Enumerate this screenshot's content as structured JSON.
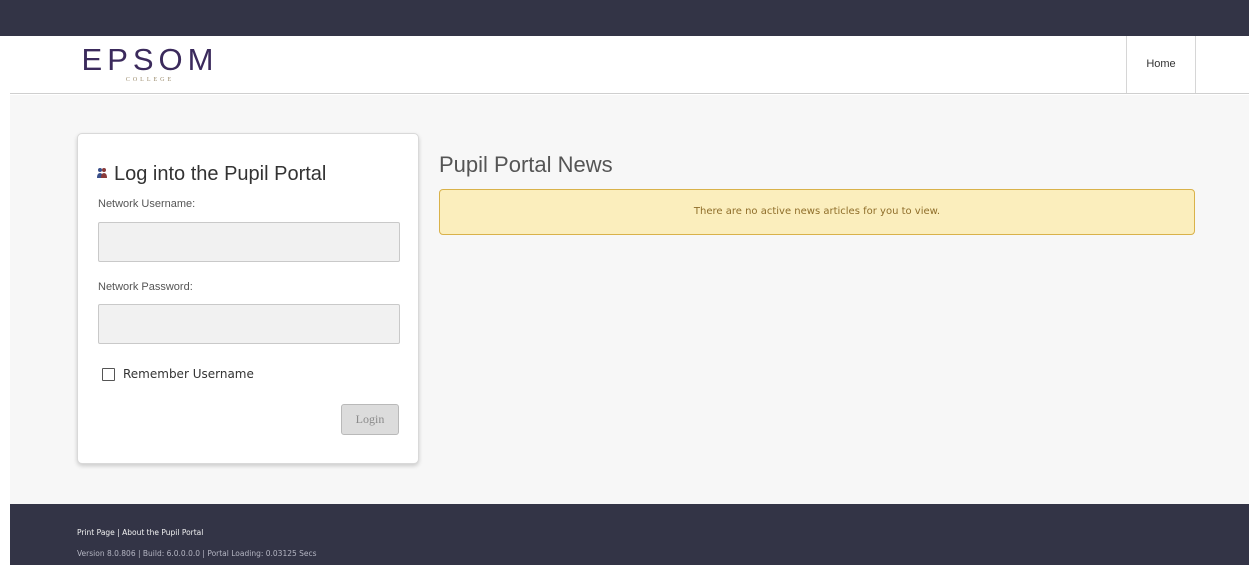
{
  "header": {
    "logo_main": "EPSOM",
    "logo_sub": "COLLEGE",
    "nav_home": "Home"
  },
  "login": {
    "title": "Log into the Pupil Portal",
    "username_label": "Network Username:",
    "username_value": "",
    "password_label": "Network Password:",
    "password_value": "",
    "remember_label": "Remember Username",
    "remember_checked": false,
    "button_label": "Login",
    "title_icon": "users-icon"
  },
  "news": {
    "title": "Pupil Portal News",
    "alert_text": "There are no active news articles for you to view."
  },
  "footer": {
    "print_page": "Print Page",
    "separator": "|",
    "about": "About the Pupil Portal",
    "version_line": "Version 8.0.806 | Build: 6.0.0.0.0 | Portal Loading: 0.03125 Secs"
  },
  "colors": {
    "topbar": "#333446",
    "footer": "#333446",
    "brand_purple": "#3b2a5c",
    "alert_bg": "#fbeebd",
    "alert_border": "#d9b24a"
  }
}
